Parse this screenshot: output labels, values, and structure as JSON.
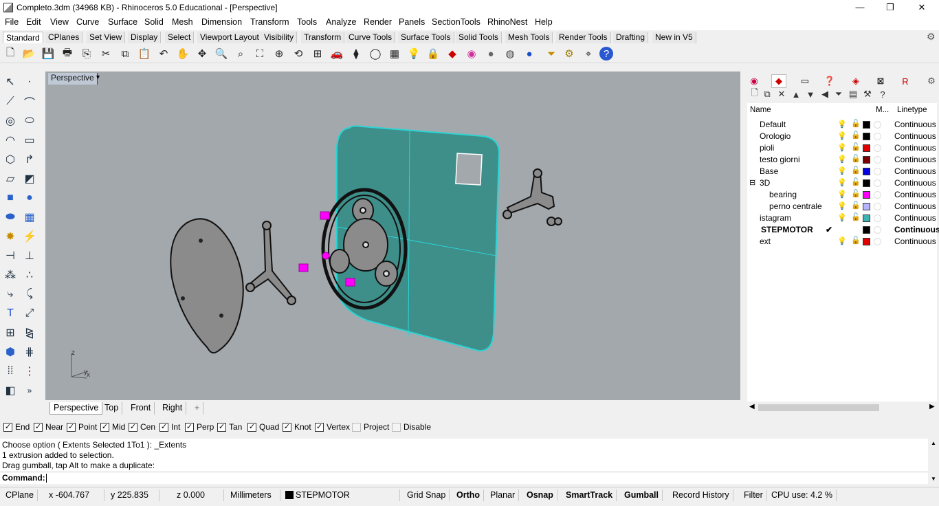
{
  "window": {
    "title": "Completo.3dm (34968 KB) - Rhinoceros 5.0 Educational - [Perspective]",
    "minimize": "—",
    "maximize": "❐",
    "close": "✕"
  },
  "menu": [
    "File",
    "Edit",
    "View",
    "Curve",
    "Surface",
    "Solid",
    "Mesh",
    "Dimension",
    "Transform",
    "Tools",
    "Analyze",
    "Render",
    "Panels",
    "SectionTools",
    "RhinoNest",
    "Help"
  ],
  "toolbar_tabs": [
    "Standard",
    "CPlanes",
    "Set View",
    "Display",
    "Select",
    "Viewport Layout",
    "Visibility",
    "Transform",
    "Curve Tools",
    "Surface Tools",
    "Solid Tools",
    "Mesh Tools",
    "Render Tools",
    "Drafting",
    "New in V5"
  ],
  "toolbar_icons": [
    "new-icon",
    "open-icon",
    "save-icon",
    "print-icon",
    "import-icon",
    "cut-icon",
    "copy-icon",
    "paste-icon",
    "undo-icon",
    "pan-icon",
    "rotate-view-icon",
    "zoom-icon",
    "zoom-window-icon",
    "zoom-extents-icon",
    "zoom-selected-icon",
    "rotate-icon",
    "viewport-layout-icon",
    "car-icon",
    "cplane-icon",
    "circle-icon",
    "grid-icon",
    "light-icon",
    "lock-icon",
    "layer-icon",
    "color-wheel-icon",
    "sphere-icon",
    "render-sphere-icon",
    "blue-sphere-icon",
    "filter-icon",
    "gear-icon",
    "dimension-icon",
    "help-icon"
  ],
  "viewport": {
    "label": "Perspective",
    "dropdown": "▾",
    "axis_z": "z",
    "axis_y": "y",
    "axis_x": "x"
  },
  "view_tabs": [
    "Perspective",
    "Top",
    "Front",
    "Right"
  ],
  "add_view": "+",
  "osnaps": [
    {
      "label": "End",
      "on": true
    },
    {
      "label": "Near",
      "on": true
    },
    {
      "label": "Point",
      "on": true
    },
    {
      "label": "Mid",
      "on": true
    },
    {
      "label": "Cen",
      "on": true
    },
    {
      "label": "Int",
      "on": true
    },
    {
      "label": "Perp",
      "on": true
    },
    {
      "label": "Tan",
      "on": true
    },
    {
      "label": "Quad",
      "on": true
    },
    {
      "label": "Knot",
      "on": true
    },
    {
      "label": "Vertex",
      "on": true
    },
    {
      "label": "Project",
      "on": false
    },
    {
      "label": "Disable",
      "on": false
    }
  ],
  "command_history": [
    "Choose option ( Extents  Selected  1To1 ): _Extents",
    "1 extrusion added to selection.",
    "Drag gumball, tap Alt to make a duplicate:"
  ],
  "command_prompt": "Command:",
  "status": {
    "cplane": "CPlane",
    "x": "x -604.767",
    "y": "y 225.835",
    "z": "z 0.000",
    "units": "Millimeters",
    "layer": "STEPMOTOR",
    "layer_color": "#000000",
    "grid_snap": "Grid Snap",
    "ortho": "Ortho",
    "planar": "Planar",
    "osnap": "Osnap",
    "smarttrack": "SmartTrack",
    "gumball": "Gumball",
    "record_history": "Record History",
    "filter": "Filter",
    "cpu": "CPU use: 4.2 %"
  },
  "layers_panel": {
    "header_name": "Name",
    "header_material": "M...",
    "header_linetype": "Linetype",
    "collapse_glyph": "⊟",
    "current_mark": "✔",
    "layers": [
      {
        "name": "Default",
        "color": "#000000",
        "linetype": "Continuous"
      },
      {
        "name": "Orologio",
        "color": "#000000",
        "linetype": "Continuous"
      },
      {
        "name": "pioli",
        "color": "#e00000",
        "linetype": "Continuous"
      },
      {
        "name": "testo giorni",
        "color": "#7a0000",
        "linetype": "Continuous"
      },
      {
        "name": "Base",
        "color": "#0000e0",
        "linetype": "Continuous"
      },
      {
        "name": "3D",
        "color": "#000000",
        "linetype": "Continuous"
      },
      {
        "name": "bearing",
        "color": "#ff00ff",
        "linetype": "Continuous"
      },
      {
        "name": "perno centrale",
        "color": "#b4b4ff",
        "linetype": "Continuous"
      },
      {
        "name": "istagram",
        "color": "#3cb4b4",
        "linetype": "Continuous"
      },
      {
        "name": "STEPMOTOR",
        "color": "#000000",
        "linetype": "Continuous"
      },
      {
        "name": "ext",
        "color": "#e00000",
        "linetype": "Continuous"
      }
    ]
  },
  "colors": {
    "viewport_bg": "#a3a8ad",
    "panel_teal": "#3e8e8a",
    "selection_cyan": "#2ad4d4",
    "bearing_magenta": "#ff00ff"
  }
}
